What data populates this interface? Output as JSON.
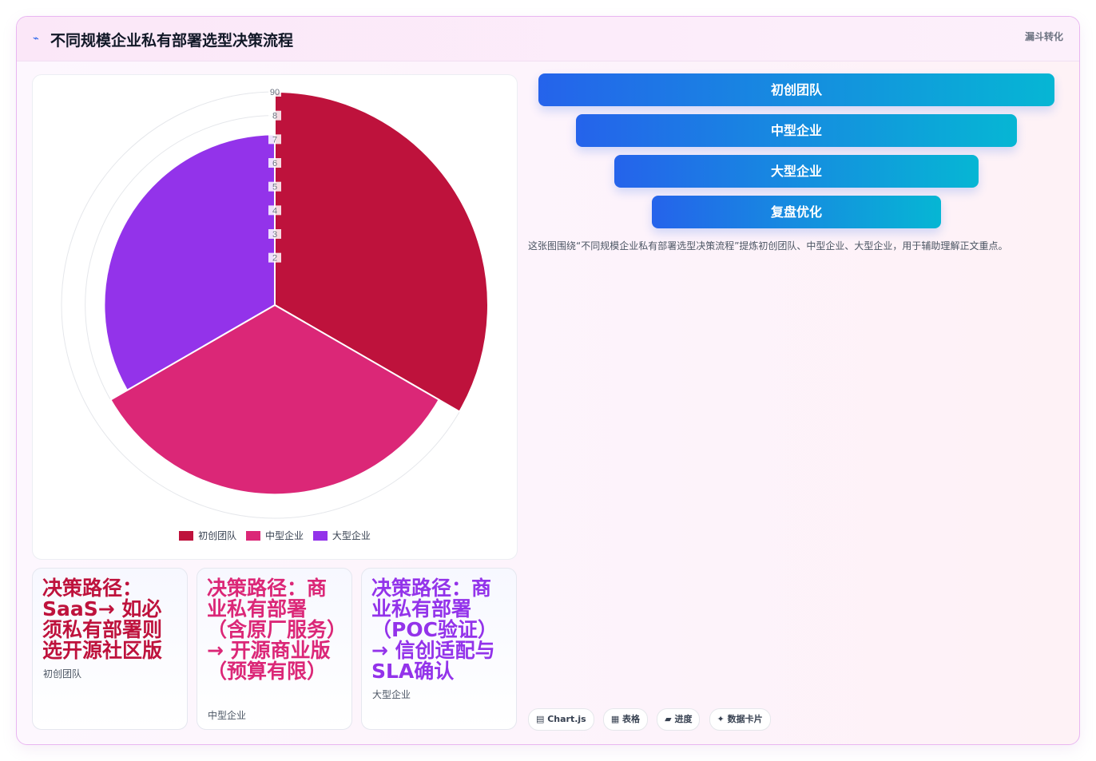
{
  "header": {
    "icon": "chart-line-icon",
    "title": "不同规模企业私有部署选型决策流程",
    "tag": "漏斗转化"
  },
  "chart_data": {
    "type": "polarArea",
    "categories": [
      "初创团队",
      "中型企业",
      "大型企业"
    ],
    "values": [
      90,
      80,
      72
    ],
    "colors": [
      "#be123c",
      "#db2777",
      "#9333ea"
    ],
    "r_max": 90,
    "r_ticks": [
      20,
      30,
      40,
      50,
      60,
      70,
      80,
      90
    ],
    "r_tick_labels": [
      "2",
      "3",
      "4",
      "5",
      "6",
      "7",
      "8",
      "90"
    ],
    "legend": "bottom"
  },
  "cards": [
    {
      "title": "决策路径：SaaS→ 如必须私有部署则选开源社区版",
      "subtitle": "初创团队",
      "color": "#be123c"
    },
    {
      "title": "决策路径：商业私有部署（含原厂服务）→ 开源商业版（预算有限）",
      "subtitle": "中型企业",
      "color": "#db2777"
    },
    {
      "title": "决策路径：商业私有部署（POC验证）→ 信创适配与SLA确认",
      "subtitle": "大型企业",
      "color": "#9333ea"
    }
  ],
  "funnel": [
    "初创团队",
    "中型企业",
    "大型企业",
    "复盘优化"
  ],
  "description": "这张图围绕“不同规模企业私有部署选型决策流程”提炼初创团队、中型企业、大型企业，用于辅助理解正文重点。",
  "chips": [
    "▤ Chart.js",
    "▦ 表格",
    "▰ 进度",
    "✦ 数据卡片"
  ]
}
